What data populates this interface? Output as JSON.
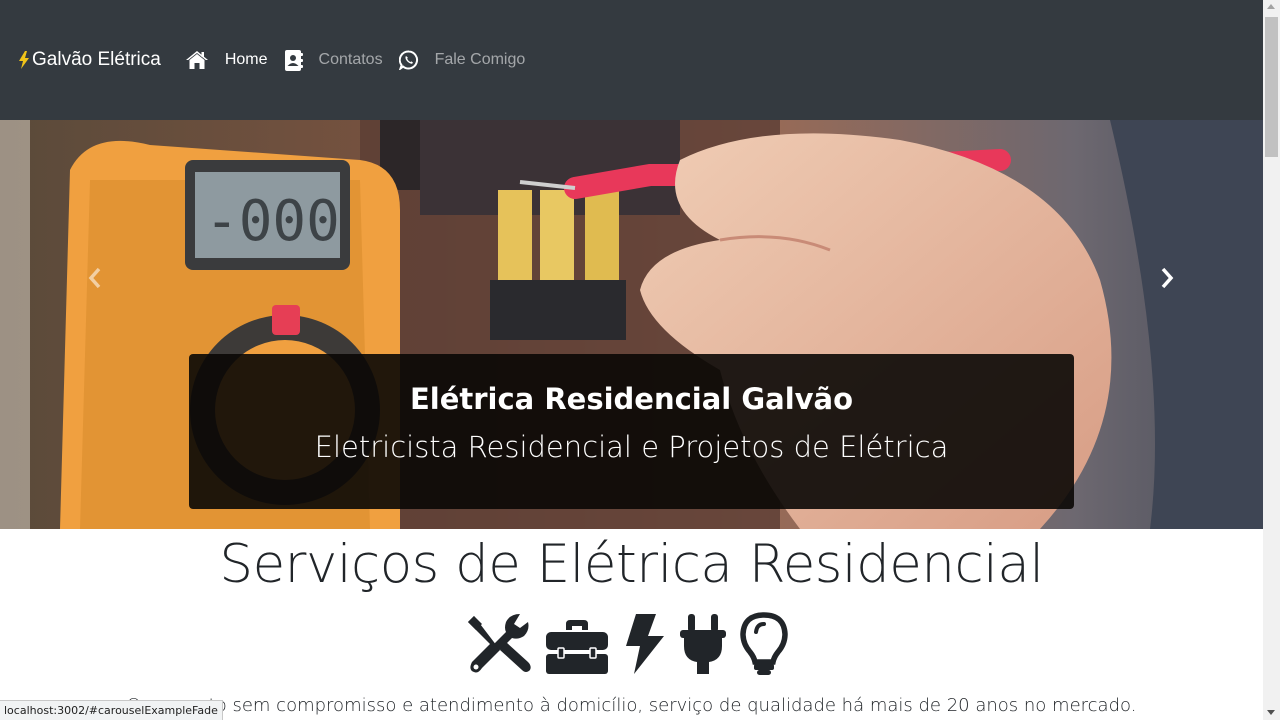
{
  "navbar": {
    "brand": "Galvão Elétrica",
    "items": [
      {
        "label": "Home",
        "icon": "home-icon",
        "active": true
      },
      {
        "label": "Contatos",
        "icon": "address-book-icon",
        "active": false
      },
      {
        "label": "Fale Comigo",
        "icon": "whatsapp-icon",
        "active": false
      }
    ]
  },
  "carousel": {
    "caption_title": "Elétrica Residencial Galvão",
    "caption_subtitle": "Eletricista Residencial e Projetos de Elétrica"
  },
  "content": {
    "section_title": "Serviços de Elétrica Residencial",
    "service_icons": [
      "tools-icon",
      "toolbox-icon",
      "bolt-icon",
      "plug-icon",
      "lightbulb-icon"
    ],
    "description": "Orçamento sem compromisso e atendimento à domicílio, serviço de qualidade há mais de 20 anos no mercado."
  },
  "status_bar": {
    "url": "localhost:3002/#carouselExampleFade"
  },
  "colors": {
    "navbar_bg": "#343a40",
    "nav_active": "#ffffff",
    "nav_inactive": "rgba(255,255,255,0.55)",
    "bolt": "#f0c419"
  }
}
